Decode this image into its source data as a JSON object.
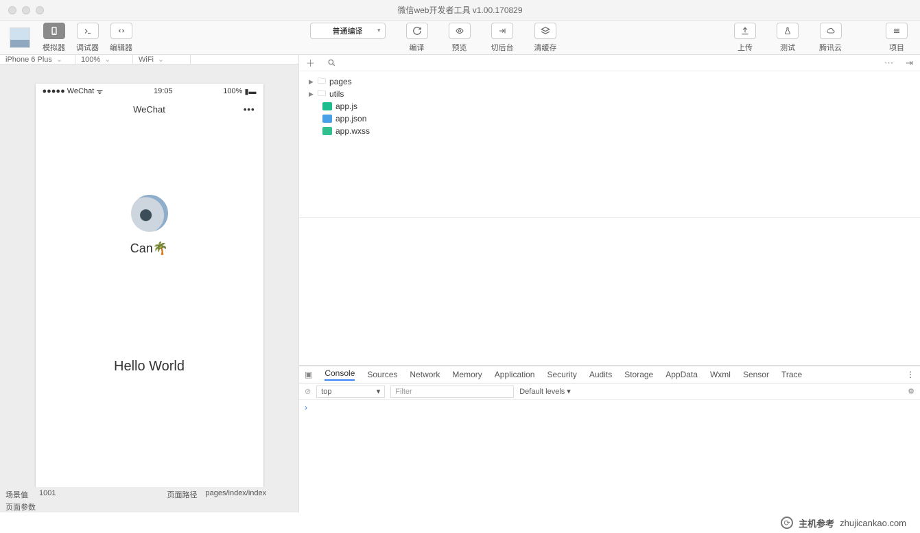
{
  "window": {
    "title": "微信web开发者工具 v1.00.170829"
  },
  "toolbar": {
    "left": [
      {
        "icon": "phone-icon",
        "label": "模拟器",
        "dark": true
      },
      {
        "icon": "debug-icon",
        "label": "调试器"
      },
      {
        "icon": "code-icon",
        "label": "编辑器"
      }
    ],
    "compile_mode": "普通编译",
    "center": [
      {
        "icon": "refresh-icon",
        "label": "编译"
      },
      {
        "icon": "eye-icon",
        "label": "预览"
      },
      {
        "icon": "switch-icon",
        "label": "切后台"
      },
      {
        "icon": "stack-icon",
        "label": "清缓存"
      }
    ],
    "right": [
      {
        "icon": "upload-icon",
        "label": "上传"
      },
      {
        "icon": "flask-icon",
        "label": "测试"
      },
      {
        "icon": "cloud-icon",
        "label": "腾讯云"
      },
      {
        "icon": "menu-icon",
        "label": "项目"
      }
    ]
  },
  "simulator": {
    "device": "iPhone 6 Plus",
    "zoom": "100%",
    "network": "WiFi",
    "status": {
      "carrier": "WeChat",
      "time": "19:05",
      "battery": "100%"
    },
    "nav_title": "WeChat",
    "user_name": "Can🌴",
    "hello": "Hello World",
    "footer": {
      "scene_label": "场景值",
      "scene_value": "1001",
      "route_label": "页面路径",
      "route_value": "pages/index/index",
      "params_label": "页面参数"
    }
  },
  "tree": {
    "folders": [
      "pages",
      "utils"
    ],
    "files": [
      {
        "name": "app.js",
        "kind": "js"
      },
      {
        "name": "app.json",
        "kind": "json"
      },
      {
        "name": "app.wxss",
        "kind": "wxss"
      }
    ]
  },
  "devtools": {
    "tabs": [
      "Console",
      "Sources",
      "Network",
      "Memory",
      "Application",
      "Security",
      "Audits",
      "Storage",
      "AppData",
      "Wxml",
      "Sensor",
      "Trace"
    ],
    "active_tab": "Console",
    "context": "top",
    "filter_placeholder": "Filter",
    "levels": "Default levels ▾",
    "prompt": "›"
  },
  "watermark": {
    "brand": "主机参考",
    "domain": "zhujicankao.com"
  }
}
